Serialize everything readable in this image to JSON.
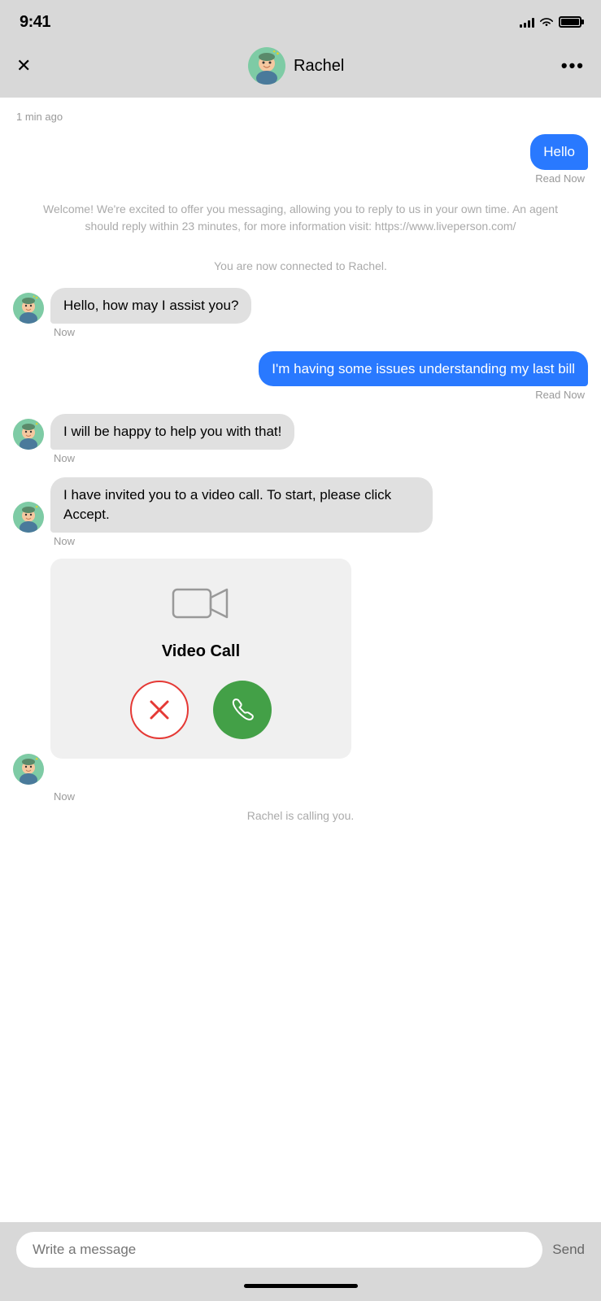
{
  "statusBar": {
    "time": "9:41",
    "signal": [
      4,
      6,
      8,
      10,
      12
    ],
    "battery": 100
  },
  "header": {
    "close_label": "✕",
    "agent_name": "Rachel",
    "more_label": "•••"
  },
  "chat": {
    "timestamp": "1 min ago",
    "messages": [
      {
        "id": "msg1",
        "type": "sent",
        "text": "Hello",
        "status": "Read  Now"
      },
      {
        "id": "system1",
        "type": "system",
        "text": "Welcome! We're excited to offer you messaging, allowing you to reply to us in your own time. An agent should reply within 23 minutes, for more information visit: https://www.liveperson.com/"
      },
      {
        "id": "system2",
        "type": "system",
        "text": "You are now connected to Rachel."
      },
      {
        "id": "msg2",
        "type": "received",
        "text": "Hello, how may I assist you?",
        "time": "Now"
      },
      {
        "id": "msg3",
        "type": "sent",
        "text": "I'm having some issues understanding my last bill",
        "status": "Read  Now"
      },
      {
        "id": "msg4",
        "type": "received",
        "text": "I will be happy to help you with that!",
        "time": "Now"
      },
      {
        "id": "msg5",
        "type": "received",
        "text": "I have invited you to a video call. To start, please click Accept.",
        "time": "Now"
      }
    ],
    "videoCall": {
      "label": "Video Call",
      "callingText": "Rachel is calling you."
    },
    "inputPlaceholder": "Write a message",
    "sendLabel": "Send"
  }
}
